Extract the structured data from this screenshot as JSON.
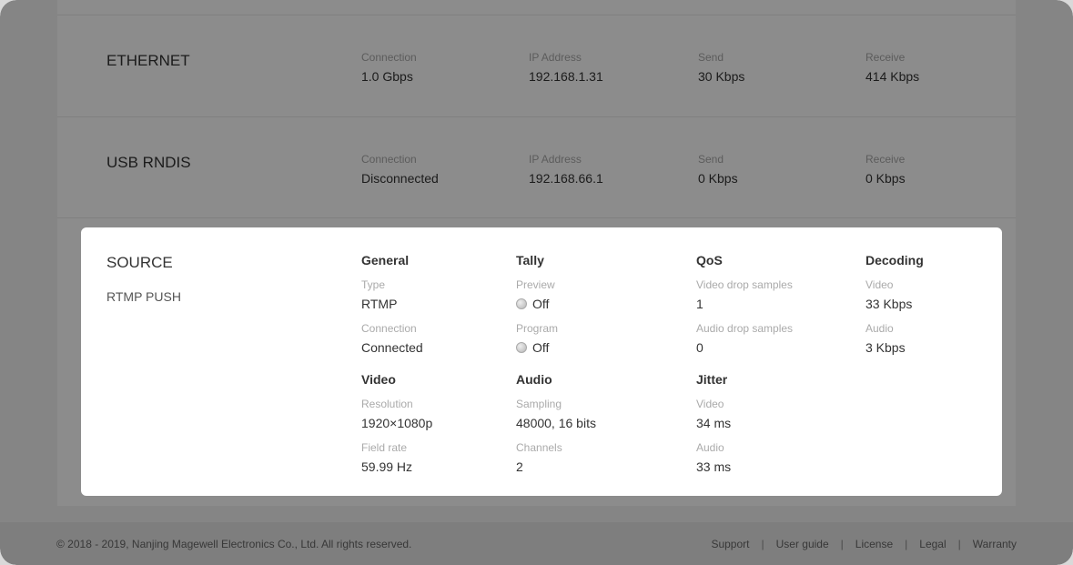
{
  "ethernet": {
    "title": "ETHERNET",
    "fields": [
      {
        "label": "Connection",
        "value": "1.0 Gbps"
      },
      {
        "label": "IP Address",
        "value": "192.168.1.31"
      },
      {
        "label": "Send",
        "value": "30 Kbps"
      },
      {
        "label": "Receive",
        "value": "414 Kbps"
      }
    ]
  },
  "usb": {
    "title": "USB RNDIS",
    "fields": [
      {
        "label": "Connection",
        "value": "Disconnected"
      },
      {
        "label": "IP Address",
        "value": "192.168.66.1"
      },
      {
        "label": "Send",
        "value": "0 Kbps"
      },
      {
        "label": "Receive",
        "value": "0 Kbps"
      }
    ]
  },
  "source": {
    "title": "SOURCE",
    "subtitle": "RTMP PUSH",
    "general": {
      "heading": "General",
      "type_label": "Type",
      "type_value": "RTMP",
      "connection_label": "Connection",
      "connection_value": "Connected"
    },
    "tally": {
      "heading": "Tally",
      "preview_label": "Preview",
      "preview_value": "Off",
      "program_label": "Program",
      "program_value": "Off"
    },
    "qos": {
      "heading": "QoS",
      "video_drop_label": "Video drop samples",
      "video_drop_value": "1",
      "audio_drop_label": "Audio drop samples",
      "audio_drop_value": "0"
    },
    "decoding": {
      "heading": "Decoding",
      "video_label": "Video",
      "video_value": "33 Kbps",
      "audio_label": "Audio",
      "audio_value": "3 Kbps"
    },
    "video": {
      "heading": "Video",
      "resolution_label": "Resolution",
      "resolution_value": "1920×1080p",
      "field_rate_label": "Field rate",
      "field_rate_value": "59.99 Hz"
    },
    "audio": {
      "heading": "Audio",
      "sampling_label": "Sampling",
      "sampling_value": "48000, 16 bits",
      "channels_label": "Channels",
      "channels_value": "2"
    },
    "jitter": {
      "heading": "Jitter",
      "video_label": "Video",
      "video_value": "34 ms",
      "audio_label": "Audio",
      "audio_value": "33 ms"
    }
  },
  "footer": {
    "copyright": "© 2018 - 2019, Nanjing Magewell Electronics Co., Ltd. All rights reserved.",
    "links": [
      "Support",
      "User guide",
      "License",
      "Legal",
      "Warranty"
    ]
  },
  "colors": {
    "overlay": "#000000",
    "modal_bg": "#ffffff",
    "page_bg": "#f3f3f3"
  }
}
